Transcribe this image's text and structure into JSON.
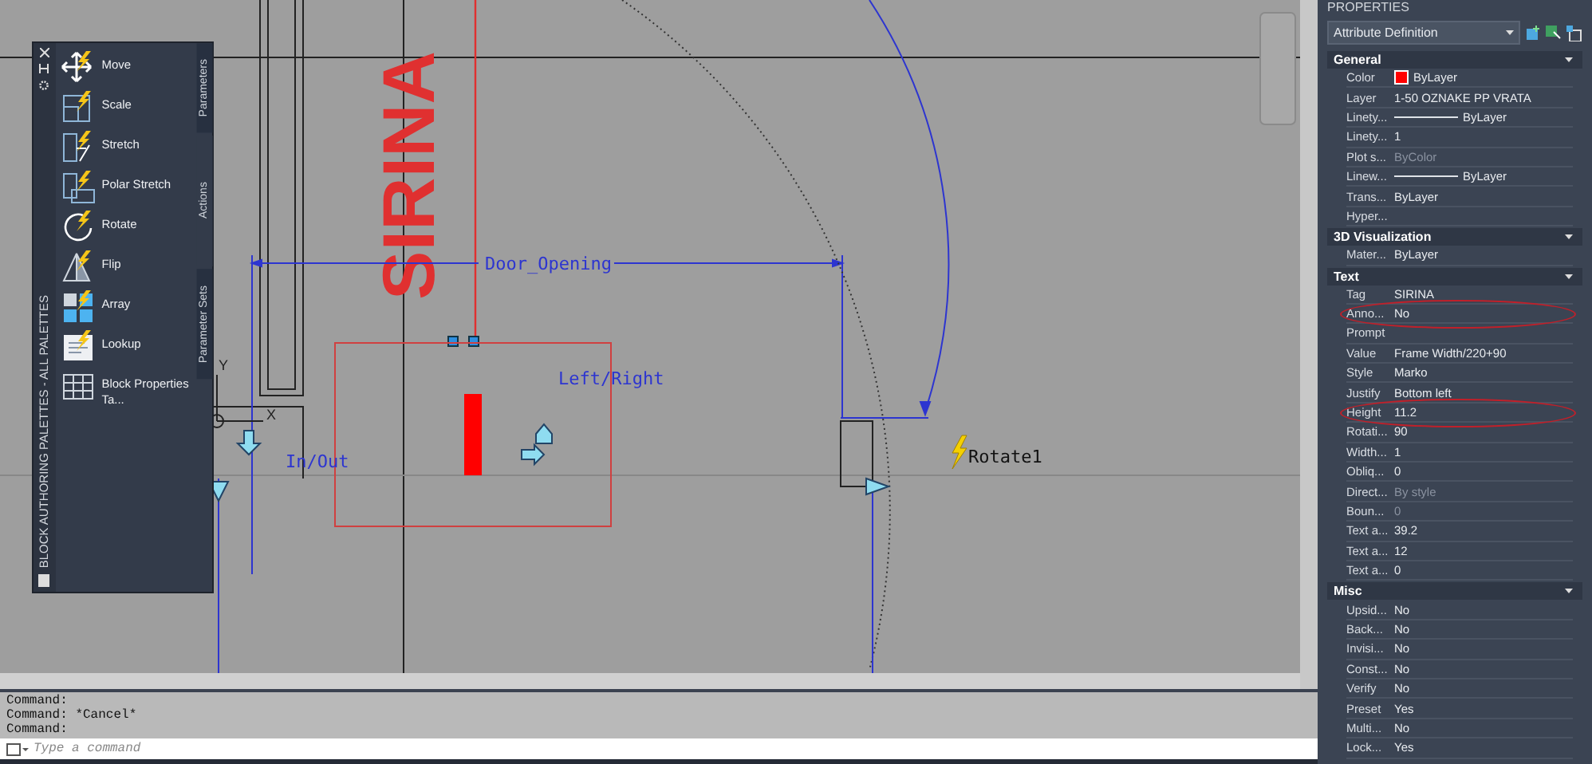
{
  "canvas": {
    "attribute_text": "SIRINA",
    "dimension_label": "Door_Opening",
    "flip_label": "Left/Right",
    "flip_label_2": "In/Out",
    "action_label": "Rotate1",
    "axis_y": "Y",
    "axis_x": "X"
  },
  "palette": {
    "title": "BLOCK AUTHORING PALETTES - ALL PALETTES",
    "tabs": [
      {
        "label": "Parameters",
        "selected": false
      },
      {
        "label": "Actions",
        "selected": true
      },
      {
        "label": "Parameter Sets",
        "selected": false
      }
    ],
    "items": [
      {
        "label": "Move",
        "kind": "move"
      },
      {
        "label": "Scale",
        "kind": "scale"
      },
      {
        "label": "Stretch",
        "kind": "stretch"
      },
      {
        "label": "Polar Stretch",
        "kind": "polar"
      },
      {
        "label": "Rotate",
        "kind": "rotate"
      },
      {
        "label": "Flip",
        "kind": "flip"
      },
      {
        "label": "Array",
        "kind": "array"
      },
      {
        "label": "Lookup",
        "kind": "lookup"
      },
      {
        "label": "Block Properties  Ta...",
        "kind": "table"
      }
    ]
  },
  "properties": {
    "title": "PROPERTIES",
    "selector": "Attribute Definition",
    "sections": [
      {
        "name": "General",
        "rows": [
          {
            "label": "Color",
            "value": "ByLayer",
            "kind": "color",
            "disabled": false,
            "highlighted": false
          },
          {
            "label": "Layer",
            "value": "1-50 OZNAKE PP VRATA",
            "kind": "text",
            "disabled": false,
            "highlighted": false
          },
          {
            "label": "Linety...",
            "value": "ByLayer",
            "kind": "line",
            "disabled": false,
            "highlighted": false
          },
          {
            "label": "Linety...",
            "value": "1",
            "kind": "text",
            "disabled": false,
            "highlighted": false
          },
          {
            "label": "Plot s...",
            "value": "ByColor",
            "kind": "text",
            "disabled": true,
            "highlighted": false
          },
          {
            "label": "Linew...",
            "value": "ByLayer",
            "kind": "line",
            "disabled": false,
            "highlighted": false
          },
          {
            "label": "Trans...",
            "value": "ByLayer",
            "kind": "text",
            "disabled": false,
            "highlighted": false
          },
          {
            "label": "Hyper...",
            "kind": "text",
            "disabled": false,
            "highlighted": false
          }
        ]
      },
      {
        "name": "3D Visualization",
        "rows": [
          {
            "label": "Mater...",
            "value": "ByLayer",
            "kind": "text",
            "disabled": false,
            "highlighted": false
          }
        ]
      },
      {
        "name": "Text",
        "rows": [
          {
            "label": "Tag",
            "value": "SIRINA",
            "kind": "text",
            "disabled": false,
            "highlighted": false
          },
          {
            "label": "Anno...",
            "value": "No",
            "kind": "text",
            "disabled": false,
            "highlighted": true
          },
          {
            "label": "Prompt",
            "kind": "text",
            "disabled": false,
            "highlighted": false
          },
          {
            "label": "Value",
            "value": "Frame Width/220+90",
            "kind": "text",
            "disabled": false,
            "highlighted": false
          },
          {
            "label": "Style",
            "value": "Marko",
            "kind": "text",
            "disabled": false,
            "highlighted": false
          },
          {
            "label": "Justify",
            "value": "Bottom left",
            "kind": "text",
            "disabled": false,
            "highlighted": false
          },
          {
            "label": "Height",
            "value": "11.2",
            "kind": "text",
            "disabled": false,
            "highlighted": true
          },
          {
            "label": "Rotati...",
            "value": "90",
            "kind": "text",
            "disabled": false,
            "highlighted": false
          },
          {
            "label": "Width...",
            "value": "1",
            "kind": "text",
            "disabled": false,
            "highlighted": false
          },
          {
            "label": "Obliq...",
            "value": "0",
            "kind": "text",
            "disabled": false,
            "highlighted": false
          },
          {
            "label": "Direct...",
            "value": "By style",
            "kind": "text",
            "disabled": true,
            "highlighted": false
          },
          {
            "label": "Boun...",
            "value": "0",
            "kind": "text",
            "disabled": true,
            "highlighted": false
          },
          {
            "label": "Text a...",
            "value": "39.2",
            "kind": "text",
            "disabled": false,
            "highlighted": false
          },
          {
            "label": "Text a...",
            "value": "12",
            "kind": "text",
            "disabled": false,
            "highlighted": false
          },
          {
            "label": "Text a...",
            "value": "0",
            "kind": "text",
            "disabled": false,
            "highlighted": false
          }
        ]
      },
      {
        "name": "Misc",
        "rows": [
          {
            "label": "Upsid...",
            "value": "No",
            "kind": "text",
            "disabled": false,
            "highlighted": false
          },
          {
            "label": "Back...",
            "value": "No",
            "kind": "text",
            "disabled": false,
            "highlighted": false
          },
          {
            "label": "Invisi...",
            "value": "No",
            "kind": "text",
            "disabled": false,
            "highlighted": false
          },
          {
            "label": "Const...",
            "value": "No",
            "kind": "text",
            "disabled": false,
            "highlighted": false
          },
          {
            "label": "Verify",
            "value": "No",
            "kind": "text",
            "disabled": false,
            "highlighted": false
          },
          {
            "label": "Preset",
            "value": "Yes",
            "kind": "text",
            "disabled": false,
            "highlighted": false
          },
          {
            "label": "Multi...",
            "value": "No",
            "kind": "text",
            "disabled": false,
            "highlighted": false
          },
          {
            "label": "Lock...",
            "value": "Yes",
            "kind": "text",
            "disabled": false,
            "highlighted": false
          }
        ]
      }
    ]
  },
  "command": {
    "history": [
      "Command:",
      "Command: *Cancel*",
      "Command:"
    ],
    "placeholder": "Type a command"
  }
}
